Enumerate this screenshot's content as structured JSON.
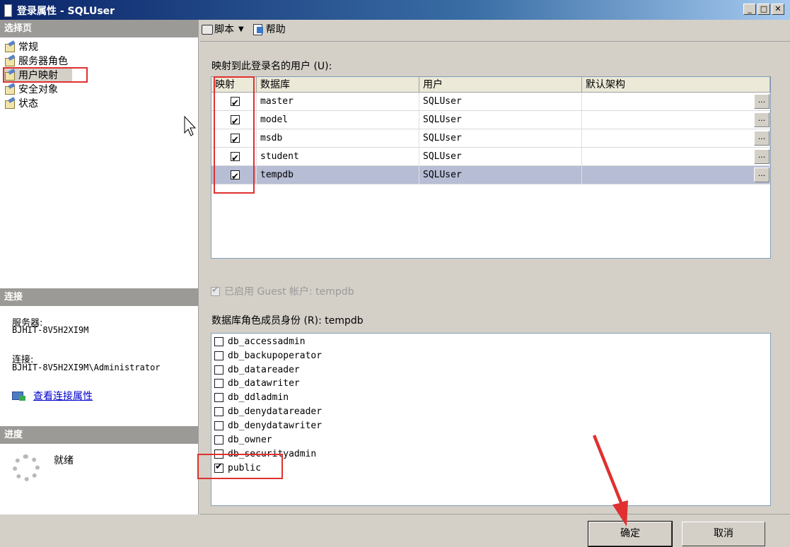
{
  "window": {
    "title": "登录属性 - SQLUser",
    "min": "_",
    "max": "□",
    "close": "✕"
  },
  "left": {
    "select_page_header": "选择页",
    "pages": [
      {
        "label": "常规"
      },
      {
        "label": "服务器角色"
      },
      {
        "label": "用户映射"
      },
      {
        "label": "安全对象"
      },
      {
        "label": "状态"
      }
    ],
    "connection_header": "连接",
    "server_label": "服务器:",
    "server_value": "BJHIT-8V5H2XI9M",
    "connection_label": "连接:",
    "connection_value": "BJHIT-8V5H2XI9M\\Administrator",
    "view_link": "查看连接属性",
    "progress_header": "进度",
    "progress_status": "就绪"
  },
  "toolbar": {
    "script_label": "脚本",
    "help_label": "帮助"
  },
  "mapping": {
    "label": "映射到此登录名的用户 (U):",
    "columns": [
      "映射",
      "数据库",
      "用户",
      "默认架构"
    ],
    "rows": [
      {
        "mapped": true,
        "database": "master",
        "user": "SQLUser",
        "schema": "",
        "selected": false
      },
      {
        "mapped": true,
        "database": "model",
        "user": "SQLUser",
        "schema": "",
        "selected": false
      },
      {
        "mapped": true,
        "database": "msdb",
        "user": "SQLUser",
        "schema": "",
        "selected": false
      },
      {
        "mapped": true,
        "database": "student",
        "user": "SQLUser",
        "schema": "",
        "selected": false
      },
      {
        "mapped": true,
        "database": "tempdb",
        "user": "SQLUser",
        "schema": "",
        "selected": true
      }
    ],
    "ellipsis": "..."
  },
  "guest": {
    "label": "已启用 Guest 帐户: tempdb",
    "checked": true
  },
  "roles": {
    "label": "数据库角色成员身份 (R): tempdb",
    "items": [
      {
        "name": "db_accessadmin",
        "checked": false
      },
      {
        "name": "db_backupoperator",
        "checked": false
      },
      {
        "name": "db_datareader",
        "checked": false
      },
      {
        "name": "db_datawriter",
        "checked": false
      },
      {
        "name": "db_ddladmin",
        "checked": false
      },
      {
        "name": "db_denydatareader",
        "checked": false
      },
      {
        "name": "db_denydatawriter",
        "checked": false
      },
      {
        "name": "db_owner",
        "checked": false
      },
      {
        "name": "db_securityadmin",
        "checked": false
      },
      {
        "name": "public",
        "checked": true
      }
    ]
  },
  "buttons": {
    "ok": "确定",
    "cancel": "取消"
  },
  "colors": {
    "annotation_red": "#e03030",
    "selected_row": "#b6bdd4",
    "title_bar": "#0a246a"
  }
}
